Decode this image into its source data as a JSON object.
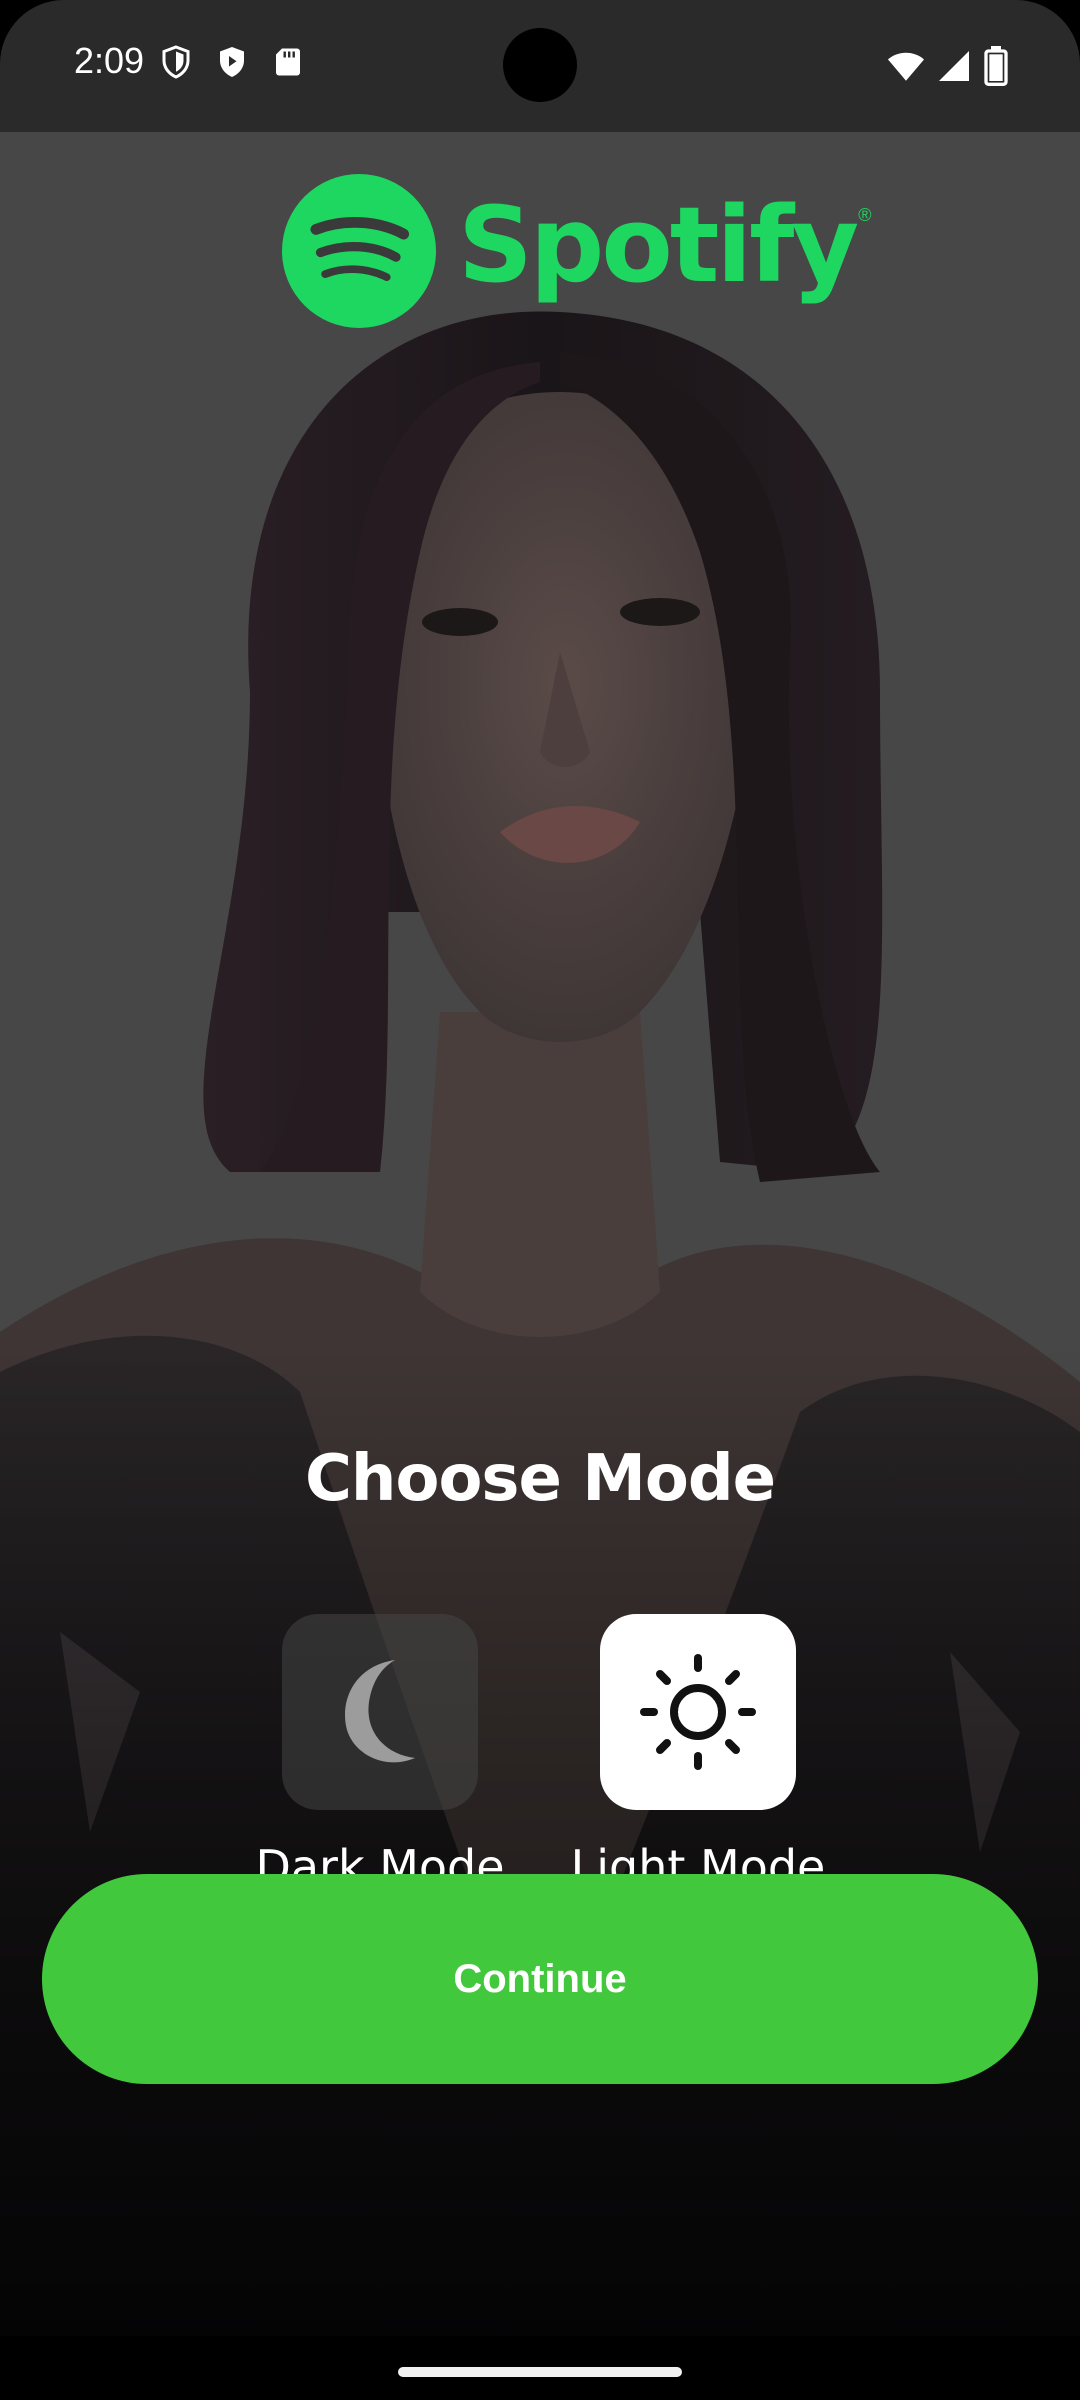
{
  "status_bar": {
    "time": "2:09",
    "left_icons": [
      "shield-outline-icon",
      "shield-filled-icon",
      "sd-card-icon"
    ],
    "right_icons": [
      "wifi-icon",
      "cell-signal-icon",
      "battery-icon"
    ]
  },
  "brand": {
    "name": "Spotify",
    "registered": "®",
    "color": "#1ed760"
  },
  "screen": {
    "title": "Choose Mode"
  },
  "modes": [
    {
      "label": "Dark Mode",
      "icon": "moon-icon",
      "selected": false
    },
    {
      "label": "Light Mode",
      "icon": "sun-icon",
      "selected": true
    }
  ],
  "continue_button": {
    "label": "Continue",
    "color": "#42c83c"
  }
}
